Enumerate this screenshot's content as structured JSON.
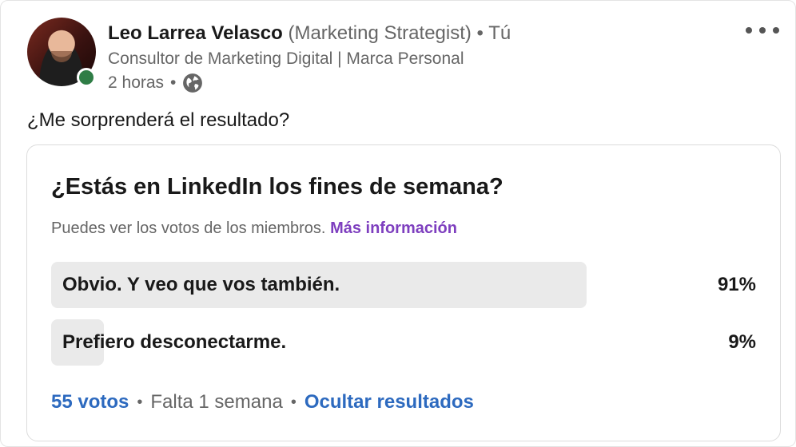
{
  "post": {
    "author_name": "Leo Larrea Velasco",
    "author_role": "(Marketing Strategist)",
    "separator": "•",
    "relation": "Tú",
    "headline": "Consultor de Marketing Digital | Marca Personal",
    "time": "2 horas",
    "visibility_icon": "globe-icon",
    "text": "¿Me sorprenderá el resultado?",
    "presence_color": "#2f7d46"
  },
  "poll": {
    "question": "¿Estás en LinkedIn los fines de semana?",
    "note": "Puedes ver los votos de los miembros.",
    "more_info": "Más información",
    "options": [
      {
        "label": "Obvio. Y veo que vos también.",
        "percent": "91%",
        "fraction": 0.76
      },
      {
        "label": "Prefiero desconectarme.",
        "percent": "9%",
        "fraction": 0.075
      }
    ],
    "votes": "55 votos",
    "remaining": "Falta 1 semana",
    "hide_results": "Ocultar resultados"
  },
  "colors": {
    "link_blue": "#2d6abf",
    "link_purple": "#7e3fbf",
    "bar_fill": "#eaeaea"
  }
}
